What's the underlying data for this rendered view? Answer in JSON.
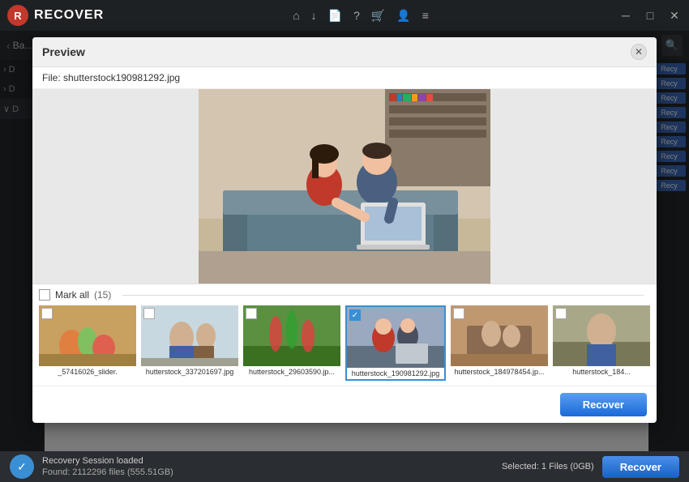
{
  "app": {
    "title": "RECOVER",
    "logo_char": "R"
  },
  "titlebar": {
    "icons": [
      "⌂",
      "↓",
      "📄",
      "?",
      "🛒",
      "👤",
      "≡"
    ],
    "controls": [
      "─",
      "□",
      "✕"
    ]
  },
  "toolbar": {
    "back_label": "Ba...",
    "search_icon": "🔍"
  },
  "preview_modal": {
    "title": "Preview",
    "filename_label": "File: shutterstock190981292.jpg",
    "close_icon": "✕",
    "mark_all_label": "Mark all",
    "count": "(15)",
    "recover_label": "Recover"
  },
  "thumbnails": [
    {
      "name": "_57416026_slider.",
      "selected": false,
      "checked": false,
      "color": "#c8a060"
    },
    {
      "name": "hutterstock_337201697.jpg",
      "selected": false,
      "checked": false,
      "color": "#b8c8d0"
    },
    {
      "name": "hutterstock_29603590.jp...",
      "selected": false,
      "checked": false,
      "color": "#5a9040"
    },
    {
      "name": "hutterstock_190981292.jpg",
      "selected": true,
      "checked": true,
      "color": "#8090a8"
    },
    {
      "name": "hutterstock_184978454.jp...",
      "selected": false,
      "checked": false,
      "color": "#c09870"
    },
    {
      "name": "hutterstock_184...",
      "selected": false,
      "checked": false,
      "color": "#a0a080"
    }
  ],
  "sidebar": {
    "items": [
      {
        "label": "D",
        "type": "collapsed"
      },
      {
        "label": "D",
        "type": "collapsed"
      },
      {
        "label": "D",
        "type": "expanded"
      }
    ]
  },
  "right_panel": {
    "recover_labels": [
      "Recy",
      "Recy",
      "Recy",
      "Recy",
      "Recy",
      "Recy",
      "Recy",
      "Recy",
      "Recy"
    ]
  },
  "statusbar": {
    "session_text": "Recovery Session loaded",
    "found_text": "Found: 2112296 files (555.51GB)",
    "selected_text": "Selected: 1 Files (0GB)",
    "recover_label": "Recover",
    "check_icon": "✓"
  }
}
